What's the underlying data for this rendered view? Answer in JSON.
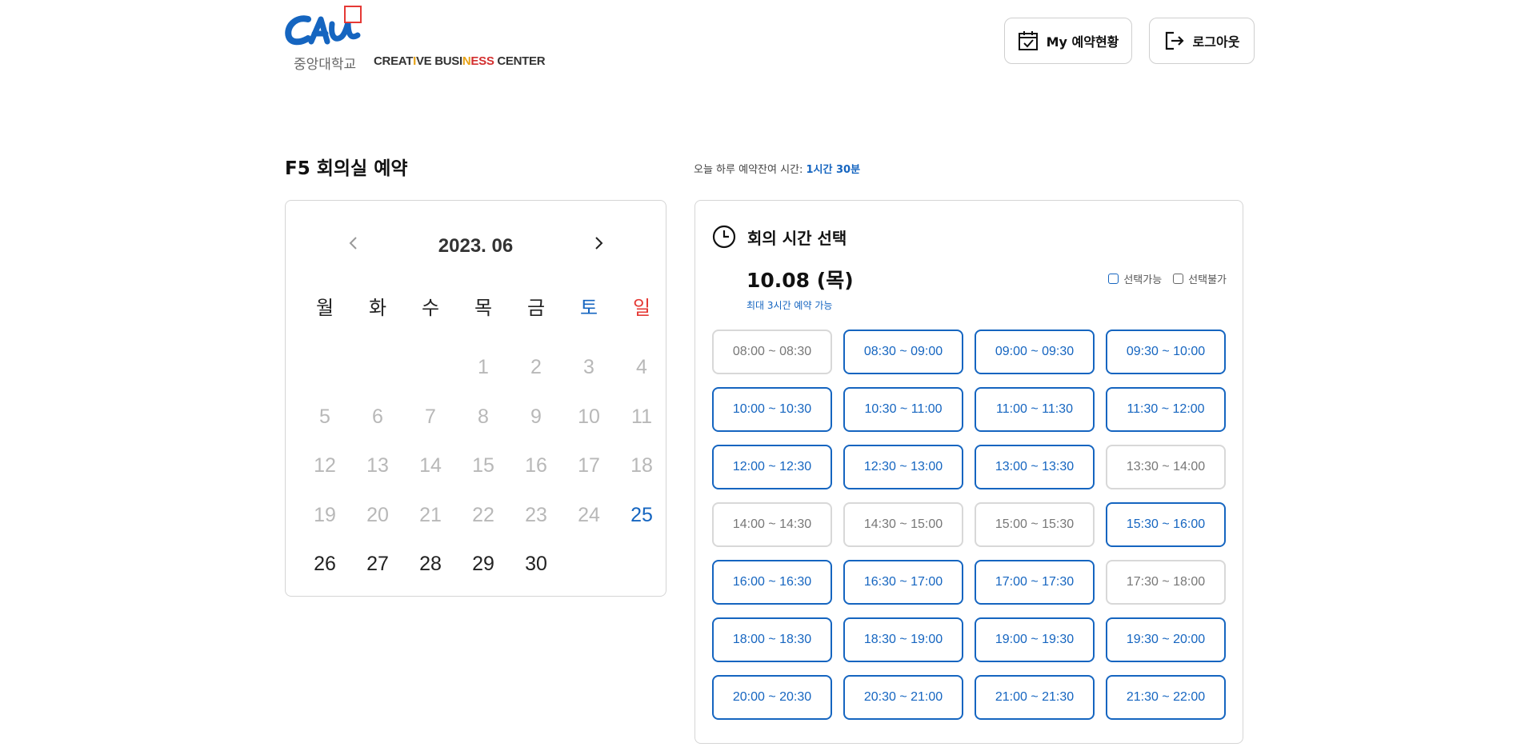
{
  "logo": {
    "mark_text": "CAU",
    "university": "중앙대학교",
    "center_prefix": "CREAT",
    "center_i": "I",
    "center_mid": "VE BUSI",
    "center_n": "N",
    "center_ess": "ESS",
    "center_suffix": " CENTER"
  },
  "header": {
    "my_reservation_label": "My 예약현황",
    "logout_label": "로그아웃"
  },
  "page_title": "F5 회의실 예약",
  "remaining": {
    "label": "오늘 하루 예약잔여 시간: ",
    "value": "1시간 30분"
  },
  "calendar": {
    "month_label": "2023. 06",
    "weekdays": [
      "월",
      "화",
      "수",
      "목",
      "금",
      "토",
      "일"
    ],
    "weeks": [
      [
        "",
        "",
        "",
        "1",
        "2",
        "3",
        "4"
      ],
      [
        "5",
        "6",
        "7",
        "8",
        "9",
        "10",
        "11"
      ],
      [
        "12",
        "13",
        "14",
        "15",
        "16",
        "17",
        "18"
      ],
      [
        "19",
        "20",
        "21",
        "22",
        "23",
        "24",
        "25"
      ],
      [
        "26",
        "27",
        "28",
        "29",
        "30",
        "",
        ""
      ]
    ],
    "today": "25",
    "past_through": 24
  },
  "time_panel": {
    "heading": "회의 시간 선택",
    "selected_date": "10.08 (목)",
    "max_note": "최대 3시간 예약 가능",
    "legend_available": "선택가능",
    "legend_unavailable": "선택불가",
    "colors": {
      "accent": "#1565c0",
      "disabled_border": "#d8d8d8"
    },
    "slots": [
      {
        "label": "08:00 ~ 08:30",
        "available": false
      },
      {
        "label": "08:30 ~ 09:00",
        "available": true
      },
      {
        "label": "09:00 ~ 09:30",
        "available": true
      },
      {
        "label": "09:30 ~ 10:00",
        "available": true
      },
      {
        "label": "10:00 ~ 10:30",
        "available": true
      },
      {
        "label": "10:30 ~ 11:00",
        "available": true
      },
      {
        "label": "11:00 ~ 11:30",
        "available": true
      },
      {
        "label": "11:30 ~ 12:00",
        "available": true
      },
      {
        "label": "12:00 ~ 12:30",
        "available": true
      },
      {
        "label": "12:30 ~ 13:00",
        "available": true
      },
      {
        "label": "13:00 ~ 13:30",
        "available": true
      },
      {
        "label": "13:30 ~ 14:00",
        "available": false
      },
      {
        "label": "14:00 ~ 14:30",
        "available": false
      },
      {
        "label": "14:30 ~ 15:00",
        "available": false
      },
      {
        "label": "15:00 ~ 15:30",
        "available": false
      },
      {
        "label": "15:30 ~ 16:00",
        "available": true
      },
      {
        "label": "16:00 ~ 16:30",
        "available": true
      },
      {
        "label": "16:30 ~ 17:00",
        "available": true
      },
      {
        "label": "17:00 ~ 17:30",
        "available": true
      },
      {
        "label": "17:30 ~ 18:00",
        "available": false
      },
      {
        "label": "18:00 ~ 18:30",
        "available": true
      },
      {
        "label": "18:30 ~ 19:00",
        "available": true
      },
      {
        "label": "19:00 ~ 19:30",
        "available": true
      },
      {
        "label": "19:30 ~ 20:00",
        "available": true
      },
      {
        "label": "20:00 ~ 20:30",
        "available": true
      },
      {
        "label": "20:30 ~ 21:00",
        "available": true
      },
      {
        "label": "21:00 ~ 21:30",
        "available": true
      },
      {
        "label": "21:30 ~ 22:00",
        "available": true
      }
    ]
  }
}
